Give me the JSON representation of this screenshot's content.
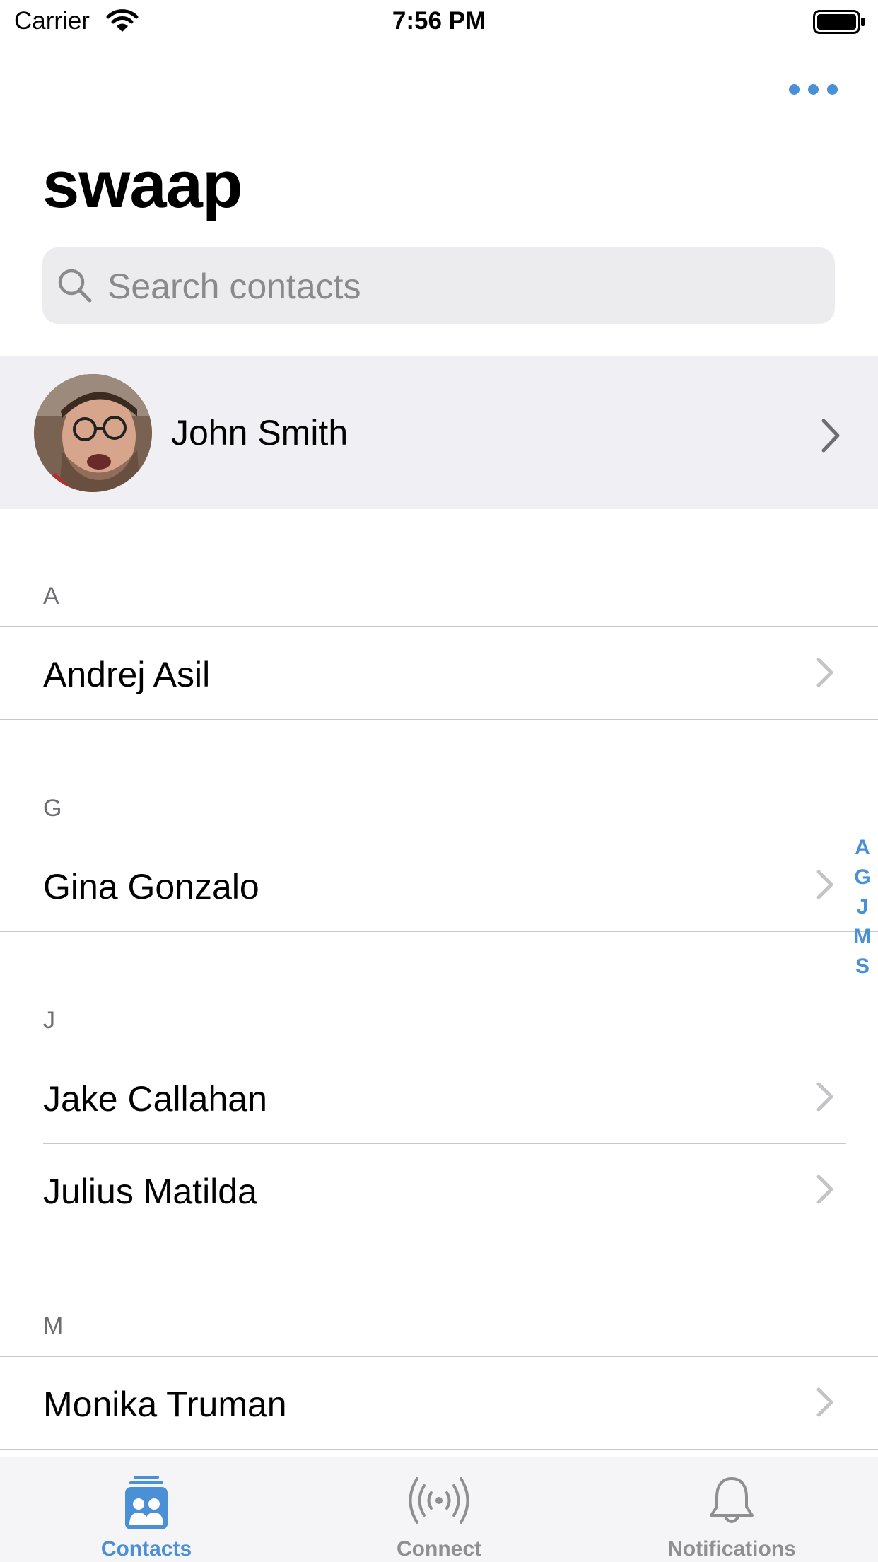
{
  "status_bar": {
    "carrier": "Carrier",
    "time": "7:56 PM"
  },
  "header": {
    "title": "swaap",
    "more_icon": "ellipsis-icon"
  },
  "search": {
    "placeholder": "Search contacts",
    "value": ""
  },
  "profile": {
    "name": "John Smith"
  },
  "sections": [
    {
      "letter": "A",
      "contacts": [
        "Andrej Asil"
      ]
    },
    {
      "letter": "G",
      "contacts": [
        "Gina Gonzalo"
      ]
    },
    {
      "letter": "J",
      "contacts": [
        "Jake Callahan",
        "Julius Matilda"
      ]
    },
    {
      "letter": "M",
      "contacts": [
        "Monika Truman"
      ]
    }
  ],
  "index": [
    "A",
    "G",
    "J",
    "M",
    "S"
  ],
  "tabs": [
    {
      "label": "Contacts",
      "icon": "contacts-icon",
      "active": true
    },
    {
      "label": "Connect",
      "icon": "broadcast-icon",
      "active": false
    },
    {
      "label": "Notifications",
      "icon": "bell-icon",
      "active": false
    }
  ],
  "colors": {
    "accent": "#4a90d6",
    "inactive": "#8e8e93",
    "profile_bg": "#efeff4",
    "search_bg": "#ececee"
  }
}
